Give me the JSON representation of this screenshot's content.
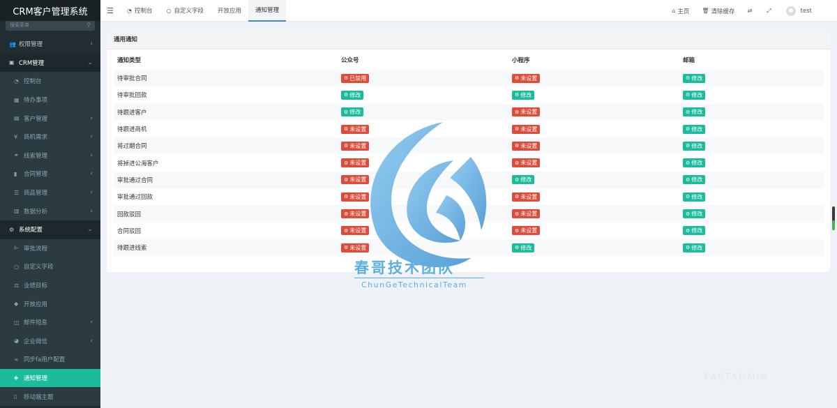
{
  "app": {
    "title": "CRM客户管理系统"
  },
  "sidebar": {
    "search_placeholder": "搜索菜单",
    "items": [
      {
        "icon": "users-icon",
        "glyph": "👥",
        "label": "权限管理",
        "arrow": "‹",
        "kind": "top"
      },
      {
        "icon": "id-card-icon",
        "glyph": "▣",
        "label": "CRM管理",
        "arrow": "⌄",
        "kind": "open"
      },
      {
        "icon": "dashboard-icon",
        "glyph": "◔",
        "label": "控制台",
        "arrow": "",
        "kind": "sub"
      },
      {
        "icon": "calendar-icon",
        "glyph": "▦",
        "label": "待办事项",
        "arrow": "",
        "kind": "sub"
      },
      {
        "icon": "address-book-icon",
        "glyph": "▤",
        "label": "客户管理",
        "arrow": "‹",
        "kind": "sub"
      },
      {
        "icon": "yen-icon",
        "glyph": "¥",
        "label": "商机需求",
        "arrow": "‹",
        "kind": "sub"
      },
      {
        "icon": "link-icon",
        "glyph": "⚭",
        "label": "线索管理",
        "arrow": "‹",
        "kind": "sub"
      },
      {
        "icon": "bookmark-icon",
        "glyph": "▮",
        "label": "合同管理",
        "arrow": "‹",
        "kind": "sub"
      },
      {
        "icon": "list-icon",
        "glyph": "☰",
        "label": "商品管理",
        "arrow": "‹",
        "kind": "sub"
      },
      {
        "icon": "bar-chart-icon",
        "glyph": "▥",
        "label": "数据分析",
        "arrow": "‹",
        "kind": "sub"
      },
      {
        "icon": "cogs-icon",
        "glyph": "⚙",
        "label": "系统配置",
        "arrow": "⌄",
        "kind": "open"
      },
      {
        "icon": "flow-icon",
        "glyph": "⊩",
        "label": "审批流程",
        "arrow": "",
        "kind": "sub"
      },
      {
        "icon": "circle-icon",
        "glyph": "○",
        "label": "自定义字段",
        "arrow": "",
        "kind": "sub"
      },
      {
        "icon": "balance-icon",
        "glyph": "⚖",
        "label": "业绩目标",
        "arrow": "",
        "kind": "sub"
      },
      {
        "icon": "cubes-icon",
        "glyph": "◆",
        "label": "开放应用",
        "arrow": "",
        "kind": "sub"
      },
      {
        "icon": "columns-icon",
        "glyph": "◫",
        "label": "邮件短息",
        "arrow": "‹",
        "kind": "sub"
      },
      {
        "icon": "wechat-icon",
        "glyph": "◕",
        "label": "企业微信",
        "arrow": "‹",
        "kind": "sub"
      },
      {
        "icon": "sync-icon",
        "glyph": "∞",
        "label": "同步fa用户配置",
        "arrow": "",
        "kind": "sub"
      },
      {
        "icon": "tag-icon",
        "glyph": "◈",
        "label": "通知管理",
        "arrow": "",
        "kind": "active"
      },
      {
        "icon": "mobile-icon",
        "glyph": "▯",
        "label": "移动端主题",
        "arrow": "",
        "kind": "sub"
      }
    ]
  },
  "topbar": {
    "tabs": [
      {
        "icon": "dashboard-icon",
        "glyph": "◔",
        "label": "控制台",
        "active": false
      },
      {
        "icon": "circle-icon",
        "glyph": "○",
        "label": "自定义字段",
        "active": false
      },
      {
        "icon": "",
        "glyph": "",
        "label": "开放应用",
        "active": false
      },
      {
        "icon": "",
        "glyph": "",
        "label": "通知管理",
        "active": true
      }
    ],
    "home": "主页",
    "clear_cache": "清除缓存",
    "user": "test"
  },
  "panel": {
    "title": "通用通知",
    "columns": [
      "通知类型",
      "公众号",
      "小程序",
      "邮箱"
    ],
    "rows": [
      {
        "type": "待审批合同",
        "mp": [
          "danger",
          "已禁用"
        ],
        "mini": [
          "danger",
          "未设置"
        ],
        "mail": [
          "success",
          "修改"
        ]
      },
      {
        "type": "待审批回款",
        "mp": [
          "success",
          "修改"
        ],
        "mini": [
          "success",
          "修改"
        ],
        "mail": [
          "success",
          "修改"
        ]
      },
      {
        "type": "待跟进客户",
        "mp": [
          "success",
          "修改"
        ],
        "mini": [
          "danger",
          "未设置"
        ],
        "mail": [
          "success",
          "修改"
        ]
      },
      {
        "type": "待跟进商机",
        "mp": [
          "danger",
          "未设置"
        ],
        "mini": [
          "danger",
          "未设置"
        ],
        "mail": [
          "success",
          "修改"
        ]
      },
      {
        "type": "将过期合同",
        "mp": [
          "danger",
          "未设置"
        ],
        "mini": [
          "danger",
          "未设置"
        ],
        "mail": [
          "success",
          "修改"
        ]
      },
      {
        "type": "将掉进公海客户",
        "mp": [
          "danger",
          "未设置"
        ],
        "mini": [
          "danger",
          "未设置"
        ],
        "mail": [
          "success",
          "修改"
        ]
      },
      {
        "type": "审批通过合同",
        "mp": [
          "danger",
          "未设置"
        ],
        "mini": [
          "success",
          "修改"
        ],
        "mail": [
          "success",
          "修改"
        ]
      },
      {
        "type": "审批通过回款",
        "mp": [
          "danger",
          "未设置"
        ],
        "mini": [
          "danger",
          "未设置"
        ],
        "mail": [
          "success",
          "修改"
        ]
      },
      {
        "type": "回款驳回",
        "mp": [
          "danger",
          "未设置"
        ],
        "mini": [
          "danger",
          "未设置"
        ],
        "mail": [
          "success",
          "修改"
        ]
      },
      {
        "type": "合同驳回",
        "mp": [
          "danger",
          "未设置"
        ],
        "mini": [
          "danger",
          "未设置"
        ],
        "mail": [
          "success",
          "修改"
        ]
      },
      {
        "type": "待跟进线索",
        "mp": [
          "danger",
          "未设置"
        ],
        "mini": [
          "success",
          "修改"
        ],
        "mail": [
          "success",
          "修改"
        ]
      }
    ]
  },
  "watermark": {
    "title": "春哥技术团队",
    "subtitle": "ChunGeTechnicalTeam",
    "corner": "FASTADMIN"
  },
  "colors": {
    "accent": "#1abc9c",
    "danger": "#dd4b39",
    "sidebar": "#222d32"
  }
}
